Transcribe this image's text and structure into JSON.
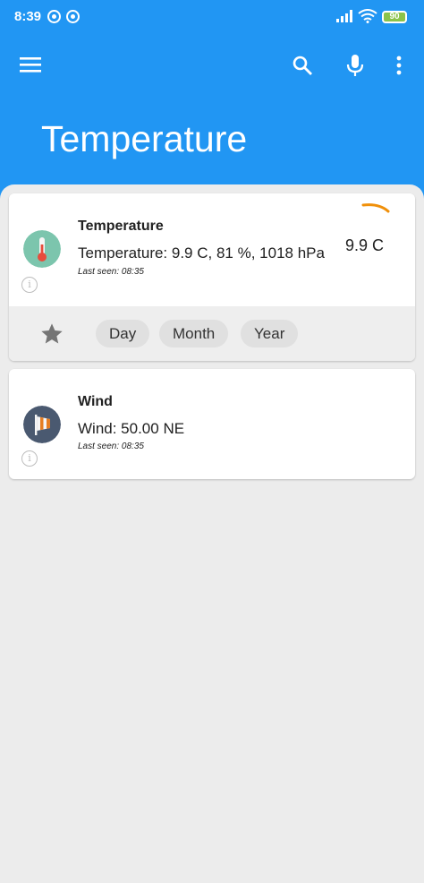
{
  "status_bar": {
    "time": "8:39",
    "battery": "90"
  },
  "toolbar": {
    "menu_icon": "menu-icon",
    "search_icon": "search-icon",
    "mic_icon": "mic-icon",
    "more_icon": "more-vert-icon"
  },
  "page": {
    "title": "Temperature"
  },
  "devices": [
    {
      "name": "Temperature",
      "data": "Temperature: 9.9 C, 81 %, 1018 hPa",
      "last_seen": "Last seen: 08:35",
      "value": "9.9 C",
      "icon": "thermometer-icon",
      "actions": {
        "favorite_icon": "star-icon",
        "chips": [
          "Day",
          "Month",
          "Year"
        ]
      }
    },
    {
      "name": "Wind",
      "data": "Wind: 50.00 NE",
      "last_seen": "Last seen: 08:35",
      "icon": "windsock-icon"
    }
  ],
  "colors": {
    "primary": "#2196f3",
    "gauge": "#f0900a",
    "background": "#ececec"
  }
}
